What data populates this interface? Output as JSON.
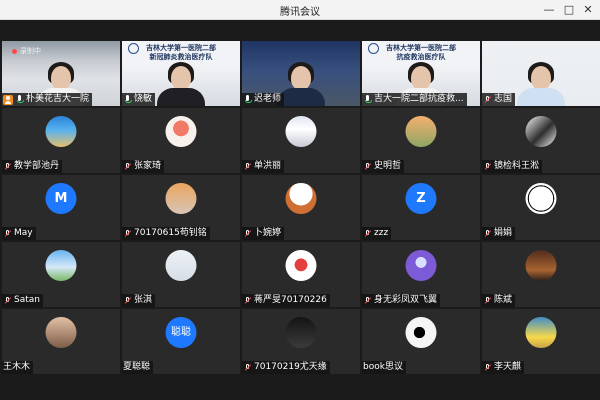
{
  "window": {
    "title": "腾讯会议",
    "controls": {
      "minimize": "—",
      "maximize": "□",
      "close": "✕"
    }
  },
  "status": {
    "recording": "录制中"
  },
  "banners": {
    "hospital_team_1": "吉林大学第一医院二部\n新冠肺炎救治医疗队",
    "hospital_team_2": "吉林大学第一医院二部\n抗疫救治医疗队"
  },
  "colors": {
    "accent_blue": "#1f79ff",
    "muted_red": "#ff4d4d",
    "mic_green": "#2fcf5a",
    "host_orange": "#f28b22"
  },
  "participants": [
    {
      "name": "朴美花吉大一院",
      "kind": "video",
      "mic": "on",
      "host": true,
      "icon": "host-icon"
    },
    {
      "name": "饶敏",
      "kind": "video",
      "mic": "on"
    },
    {
      "name": "迟老师",
      "kind": "video",
      "mic": "on"
    },
    {
      "name": "吉大一院二部抗疫救...",
      "kind": "video",
      "mic": "on"
    },
    {
      "name": "志国",
      "kind": "video",
      "mic": "muted"
    },
    {
      "name": "教学部池丹",
      "kind": "avatar",
      "mic": "muted",
      "avatar": "seashore"
    },
    {
      "name": "张家琦",
      "kind": "avatar",
      "mic": "muted",
      "avatar": "flower"
    },
    {
      "name": "单洪丽",
      "kind": "avatar",
      "mic": "muted",
      "avatar": "snow"
    },
    {
      "name": "史明哲",
      "kind": "avatar",
      "mic": "muted",
      "avatar": "family"
    },
    {
      "name": "镜检科王淞",
      "kind": "avatar",
      "mic": "muted",
      "avatar": "couple"
    },
    {
      "name": "May",
      "kind": "avatar",
      "mic": "muted",
      "avatar_letter": "M"
    },
    {
      "name": "70170615苟钊铭",
      "kind": "avatar",
      "mic": "muted",
      "avatar": "portrait"
    },
    {
      "name": "卜婉婷",
      "kind": "avatar",
      "mic": "muted",
      "avatar": "cartoon"
    },
    {
      "name": "zzz",
      "kind": "avatar",
      "mic": "muted",
      "avatar_letter": "Z"
    },
    {
      "name": "娟娟",
      "kind": "avatar",
      "mic": "muted",
      "avatar": "sketch"
    },
    {
      "name": "Satan",
      "kind": "avatar",
      "mic": "muted",
      "avatar": "sky"
    },
    {
      "name": "张淇",
      "kind": "avatar",
      "mic": "muted",
      "avatar": "anime"
    },
    {
      "name": "蒋严旻70170226",
      "kind": "avatar",
      "mic": "muted",
      "avatar": "mascot"
    },
    {
      "name": "身无彩凤双飞翼",
      "kind": "avatar",
      "mic": "muted",
      "avatar": "purple"
    },
    {
      "name": "陈斌",
      "kind": "avatar",
      "mic": "muted",
      "avatar": "sunset"
    },
    {
      "name": "王木木",
      "kind": "avatar",
      "mic": "muted",
      "avatar": "child"
    },
    {
      "name": "夏聪聪",
      "kind": "avatar",
      "mic": "muted",
      "avatar_text": "聪聪"
    },
    {
      "name": "70170219尤天缘",
      "kind": "avatar",
      "mic": "muted",
      "avatar": "dark"
    },
    {
      "name": "book思议",
      "kind": "avatar",
      "mic": "muted",
      "avatar": "letter-c"
    },
    {
      "name": "李天麒",
      "kind": "avatar",
      "mic": "muted",
      "avatar": "minion"
    }
  ]
}
